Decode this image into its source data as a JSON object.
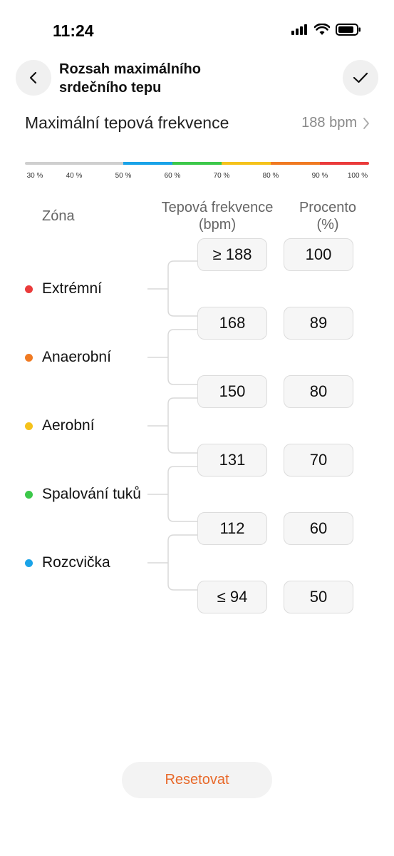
{
  "status": {
    "time": "11:24"
  },
  "header": {
    "title": "Rozsah maximálního srdečního tepu"
  },
  "max_hr": {
    "label": "Maximální tepová frekvence",
    "value": "188 bpm"
  },
  "scale": {
    "segments": [
      {
        "from": 30,
        "to": 50,
        "color": "#cfcfcf"
      },
      {
        "from": 50,
        "to": 60,
        "color": "#1aa3e8"
      },
      {
        "from": 60,
        "to": 70,
        "color": "#3cc84a"
      },
      {
        "from": 70,
        "to": 80,
        "color": "#f5c21b"
      },
      {
        "from": 80,
        "to": 90,
        "color": "#f07a22"
      },
      {
        "from": 90,
        "to": 100,
        "color": "#ea3b3b"
      }
    ],
    "ticks": [
      "30 %",
      "40 %",
      "50 %",
      "60 %",
      "70 %",
      "80 %",
      "90 %",
      "100 %"
    ]
  },
  "columns": {
    "zone": "Zóna",
    "bpm_line1": "Tepová frekvence",
    "bpm_line2": "(bpm)",
    "pct_line1": "Procento",
    "pct_line2": "(%)"
  },
  "zones": [
    {
      "label": "Extrémní",
      "color": "#ea3b3b"
    },
    {
      "label": "Anaerobní",
      "color": "#f07a22"
    },
    {
      "label": "Aerobní",
      "color": "#f5c21b"
    },
    {
      "label": "Spalování tuků",
      "color": "#3cc84a"
    },
    {
      "label": "Rozcvička",
      "color": "#1aa3e8"
    }
  ],
  "thresholds": [
    {
      "bpm": "≥ 188",
      "pct": "100"
    },
    {
      "bpm": "168",
      "pct": "89"
    },
    {
      "bpm": "150",
      "pct": "80"
    },
    {
      "bpm": "131",
      "pct": "70"
    },
    {
      "bpm": "112",
      "pct": "60"
    },
    {
      "bpm": "≤ 94",
      "pct": "50"
    }
  ],
  "reset_label": "Resetovat"
}
